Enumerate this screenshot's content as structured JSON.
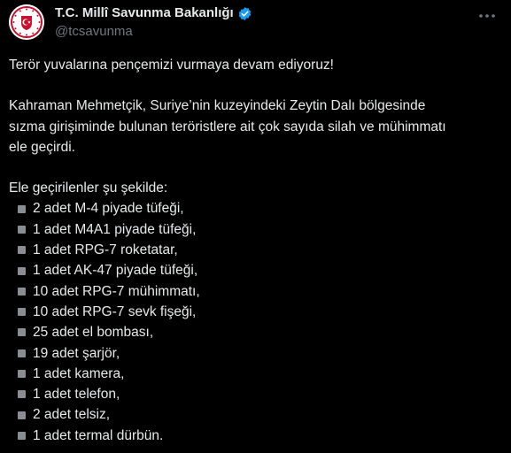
{
  "tweet": {
    "author": {
      "display_name": "T.C. Millî Savunma Bakanlığı",
      "handle": "@tcsavunma",
      "verified_icon": "verified-badge-icon",
      "avatar_icon": "turkish-ministry-emblem-icon"
    },
    "more_icon": "more-options-icon",
    "text": {
      "line1": "Terör yuvalarına pençemizi vurmaya devam ediyoruz!",
      "line2": "Kahraman Mehmetçik, Suriye’nin kuzeyindeki Zeytin Dalı bölgesinde",
      "line3": "sızma girişiminde bulunan teröristlere ait çok sayıda silah ve mühimmatı",
      "line4": "ele geçirdi.",
      "list_intro": "Ele geçirilenler şu şekilde:",
      "items": [
        "2 adet M-4 piyade tüfeği,",
        "1 adet M4A1 piyade tüfeği,",
        "1 adet RPG-7 roketatar,",
        "1 adet AK-47 piyade tüfeği,",
        "10 adet RPG-7 mühimmatı,",
        "10 adet RPG-7 sevk fişeği,",
        "25 adet el bombası,",
        "19 adet şarjör,",
        "1 adet kamera,",
        "1 adet telefon,",
        "2 adet telsiz,",
        "1 adet termal dürbün."
      ]
    }
  },
  "colors": {
    "background": "#000000",
    "text_primary": "#e7e9ea",
    "text_secondary": "#71767b",
    "verified_blue": "#1d9bf0",
    "emblem_red": "#c8102e"
  }
}
